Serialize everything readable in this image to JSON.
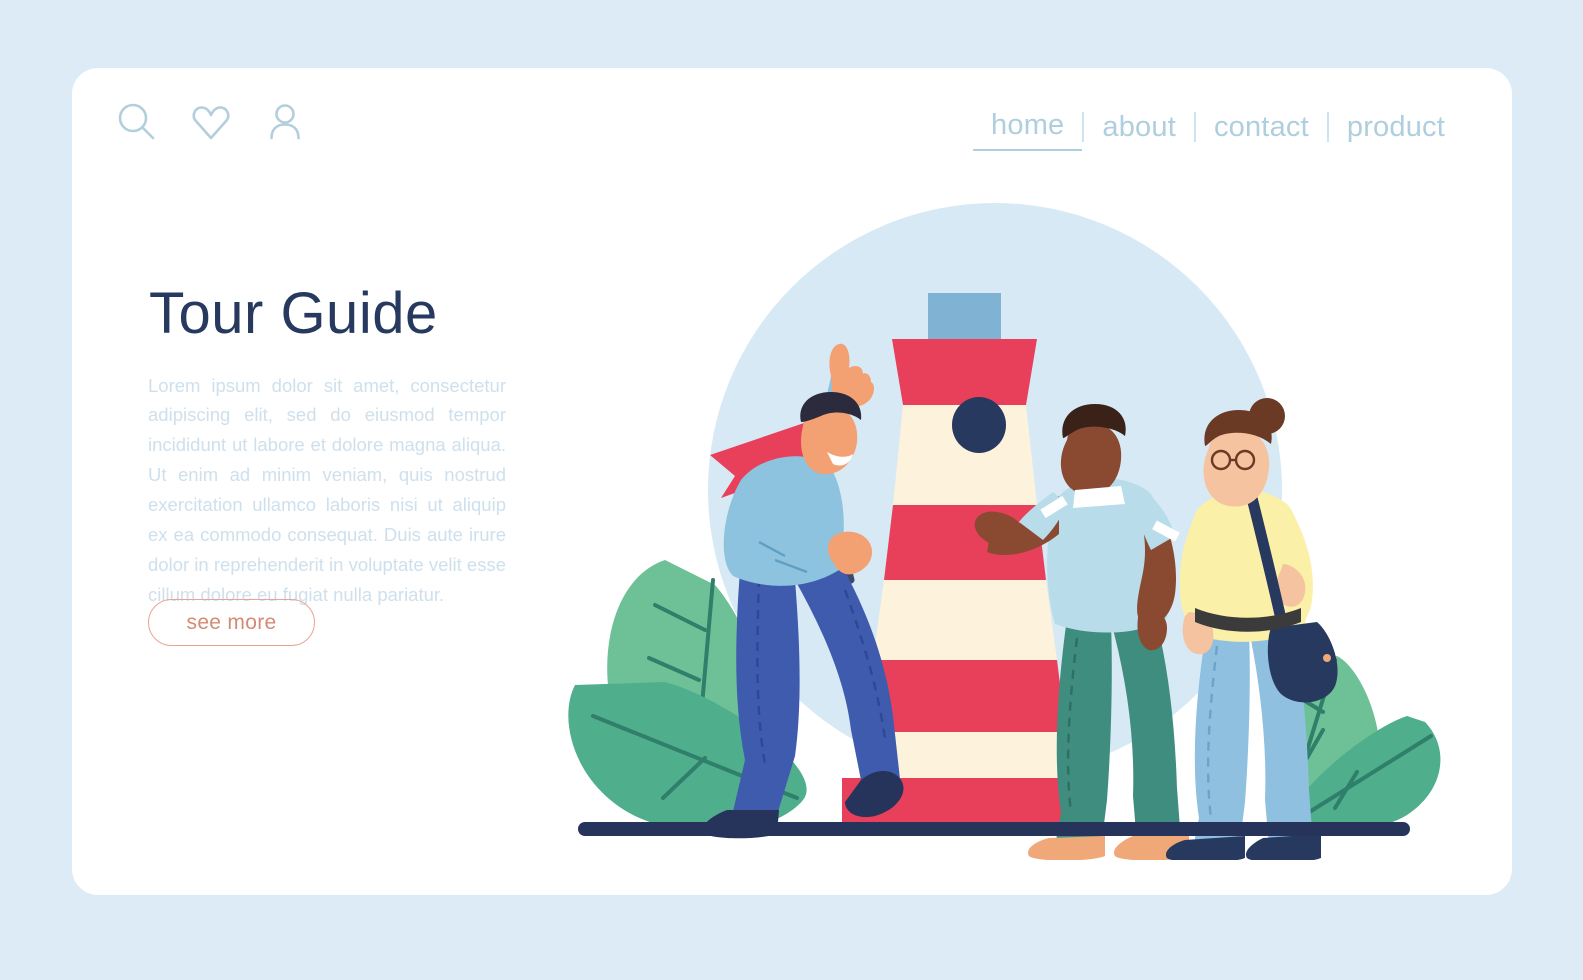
{
  "page": {
    "background_color": "#dcebf5",
    "card_color": "#ffffff"
  },
  "header": {
    "icons": [
      {
        "name": "search-icon",
        "label": "search"
      },
      {
        "name": "heart-icon",
        "label": "favorites"
      },
      {
        "name": "user-icon",
        "label": "account"
      }
    ],
    "icon_color": "#b3cedc",
    "nav": {
      "items": [
        {
          "label": "home",
          "active": true
        },
        {
          "label": "about",
          "active": false
        },
        {
          "label": "contact",
          "active": false
        },
        {
          "label": "product",
          "active": false
        }
      ],
      "color": "#afcede",
      "separator": "|"
    }
  },
  "hero": {
    "title": "Tour Guide",
    "title_color": "#27395e",
    "body": "Lorem ipsum dolor sit amet, consectetur adipiscing elit, sed do eiusmod tempor incididunt ut labore et dolore magna aliqua. Ut enim ad minim veniam, quis nostrud exercitation ullamco laboris nisi ut aliquip ex ea commodo consequat. Duis aute irure dolor in reprehenderit in voluptate velit esse cillum dolore eu fugiat nulla pariatur.",
    "body_color": "#cfe0ed",
    "cta": {
      "label": "see more",
      "text_color": "#d58a74",
      "border_color": "#e8a493"
    }
  },
  "illustration": {
    "name": "tour-guide-lighthouse-scene",
    "backdrop_circle_color": "#d6e9f5",
    "ground_color": "#26345c",
    "lighthouse": {
      "band_red": "#e8405a",
      "body_cream": "#fdf3dc",
      "lantern_cap_color": "#7fb2d3",
      "window_color": "#27395e"
    },
    "foliage": {
      "leaf_fill": "#6ec196",
      "leaf_fill_alt": "#4fae8c",
      "vein_color": "#2f7f6a"
    },
    "characters": [
      {
        "name": "tour-guide",
        "sweater_color": "#8dc3df",
        "trousers_color": "#3f5bae",
        "skin_color": "#f3a072",
        "hair_color": "#2b2b3d",
        "shoe_color": "#26345c",
        "flag_color": "#e8405a",
        "flag_pole_color": "#3b4a6b"
      },
      {
        "name": "tourist-man",
        "polo_color": "#b9dcea",
        "trousers_color": "#3f8d7f",
        "skin_color": "#8a4a32",
        "hair_color": "#3a2218",
        "shoe_color": "#f0a878"
      },
      {
        "name": "tourist-woman",
        "sweater_color": "#fbf0a8",
        "jeans_color": "#8fc0e0",
        "skin_color": "#f6c3a0",
        "hair_color": "#6b3a24",
        "bag_color": "#27395e",
        "shoe_color": "#27395e"
      }
    ]
  }
}
